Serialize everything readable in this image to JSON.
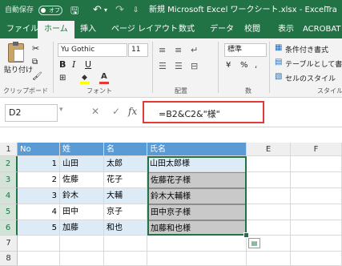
{
  "titlebar": {
    "autosave_label": "自動保存",
    "autosave_state": "オフ",
    "title": "新規 Microsoft Excel ワークシート.xlsx - Excel",
    "truncated_right": "Tra"
  },
  "ribbon_tabs": [
    "ファイル",
    "ホーム",
    "挿入",
    "ページ レイアウト",
    "数式",
    "データ",
    "校閲",
    "表示",
    "ACROBAT"
  ],
  "active_tab_index": 1,
  "ribbon": {
    "paste_label": "貼り付け",
    "clipboard_label": "クリップボード",
    "font_name": "Yu Gothic",
    "font_size": "11",
    "bold": "B",
    "italic": "I",
    "underline": "U",
    "font_group_label": "フォント",
    "align_group_label": "配置",
    "number_format": "標準",
    "number_group_label": "数",
    "cond_format": "条件付き書式",
    "table_format": "テーブルとして書",
    "cell_style": "セルのスタイル",
    "style_group_label": "スタイル",
    "percent": "%",
    "comma": ","
  },
  "formula_bar": {
    "name_box": "D2",
    "fx": "fx",
    "cancel": "✕",
    "enter": "✓",
    "formula": "=B2&C2&\"様\""
  },
  "sheet": {
    "columns": [
      "A",
      "B",
      "C",
      "D",
      "E",
      "F"
    ],
    "rows": [
      {
        "num": "1",
        "A": "No",
        "B": "姓",
        "C": "名",
        "D": "氏名"
      },
      {
        "num": "2",
        "A": "1",
        "B": "山田",
        "C": "太郎",
        "D": "山田太郎様"
      },
      {
        "num": "3",
        "A": "2",
        "B": "佐藤",
        "C": "花子",
        "D": "佐藤花子様"
      },
      {
        "num": "4",
        "A": "3",
        "B": "鈴木",
        "C": "大輔",
        "D": "鈴木大輔様"
      },
      {
        "num": "5",
        "A": "4",
        "B": "田中",
        "C": "京子",
        "D": "田中京子様"
      },
      {
        "num": "6",
        "A": "5",
        "B": "加藤",
        "C": "和也",
        "D": "加藤和也様"
      },
      {
        "num": "7"
      },
      {
        "num": "8"
      }
    ]
  },
  "colors": {
    "excel_green": "#217346",
    "header_blue": "#5b9bd5",
    "band_blue": "#ddebf7",
    "highlight_red": "#e53935"
  }
}
